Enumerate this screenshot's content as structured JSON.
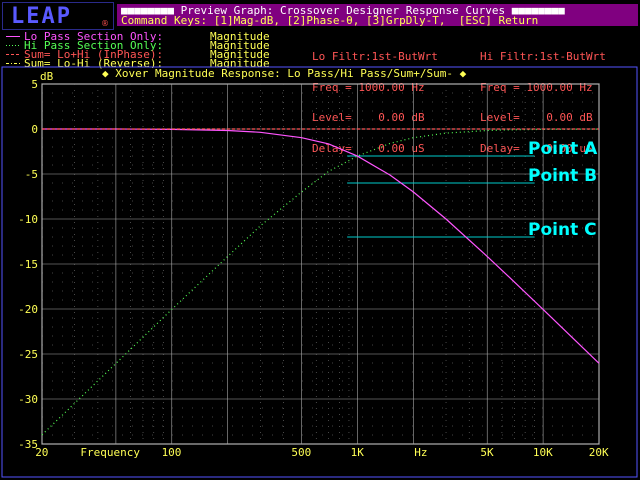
{
  "app": {
    "logo": "LEAP",
    "logo_mark": "®"
  },
  "title_bar": {
    "line1": "■■■■■■■■ Preview Graph: Crossover Designer Response Curves ■■■■■■■■",
    "line2": "Command Keys: [1]Mag-dB, [2]Phase-θ, [3]GrpDly-T,  [ESC] Return"
  },
  "legend": [
    {
      "label": "Lo Pass Section Only:",
      "value": "Magnitude",
      "color": "#ff55ff",
      "style": "solid"
    },
    {
      "label": "Hi Pass Section Only:",
      "value": "Magnitude",
      "color": "#55ff55",
      "style": "dotted"
    },
    {
      "label": "Sum= Lo+Hi (InPhase):",
      "value": "Magnitude",
      "color": "#ff5555",
      "style": "dashed"
    },
    {
      "label": "Sum= Lo-Hi (Reverse):",
      "value": "Magnitude",
      "color": "#ffff55",
      "style": "dashdot"
    }
  ],
  "filters": {
    "lo": {
      "title": "Lo Filtr:1st-ButWrt",
      "freq": "Freq = 1000.00 Hz",
      "level": "Level=    0.00 dB",
      "delay": "Delay=    0.00 uS"
    },
    "hi": {
      "title": "Hi Filtr:1st-ButWrt",
      "freq": "Freq = 1000.00 Hz",
      "level": "Level=    0.00 dB",
      "delay": "Delay=    0.00 uS"
    }
  },
  "graph": {
    "title": "◆ Xover Magnitude Response: Lo Pass/Hi Pass/Sum+/Sum- ◆",
    "y_unit": "dB",
    "y_ticks": [
      "5",
      "0",
      "-5",
      "-10",
      "-15",
      "-20",
      "-25",
      "-30",
      "-35"
    ],
    "x_ticks": [
      "20",
      "100",
      "500",
      "1K",
      "Hz",
      "5K",
      "10K",
      "20K"
    ],
    "x_caption": "Frequency",
    "points": [
      {
        "name": "Point A",
        "db": -3
      },
      {
        "name": "Point B",
        "db": -6
      },
      {
        "name": "Point C",
        "db": -12
      }
    ]
  },
  "chart_data": {
    "type": "line",
    "title": "Xover Magnitude Response: Lo Pass/Hi Pass/Sum+/Sum-",
    "xlabel": "Frequency",
    "ylabel": "dB",
    "xscale": "log",
    "xlim": [
      20,
      20000
    ],
    "ylim": [
      -35,
      5
    ],
    "grid": true,
    "x": [
      20,
      50,
      100,
      200,
      300,
      500,
      700,
      1000,
      1500,
      2000,
      3000,
      5000,
      7000,
      10000,
      20000
    ],
    "series": [
      {
        "name": "Lo Pass Section Only",
        "values": [
          0,
          0,
          -0.04,
          -0.17,
          -0.37,
          -0.97,
          -1.66,
          -3.01,
          -5.12,
          -6.99,
          -10.0,
          -14.15,
          -16.99,
          -20.04,
          -26.03
        ]
      },
      {
        "name": "Hi Pass Section Only",
        "values": [
          -33.98,
          -26.04,
          -20.04,
          -14.15,
          -10.75,
          -6.99,
          -4.7,
          -3.01,
          -1.6,
          -0.97,
          -0.46,
          -0.17,
          -0.09,
          -0.04,
          -0.01
        ]
      },
      {
        "name": "Sum= Lo+Hi (InPhase)",
        "values": [
          0,
          0,
          0,
          0,
          0,
          0,
          0,
          0,
          0,
          0,
          0,
          0,
          0,
          0,
          0
        ]
      }
    ]
  }
}
